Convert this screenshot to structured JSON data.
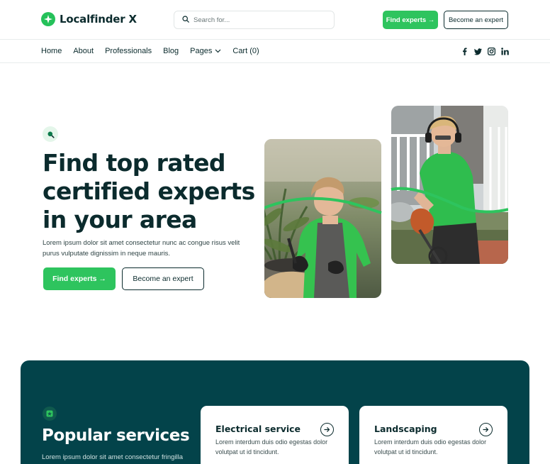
{
  "brand": {
    "name": "Localfinder X",
    "accent": "#2ec45e",
    "dark": "#03434a",
    "text": "#0b2b2d"
  },
  "search": {
    "placeholder": "Search for..."
  },
  "header": {
    "find_label": "Find experts →",
    "become_label": "Become an expert"
  },
  "nav": {
    "items": [
      {
        "label": "Home"
      },
      {
        "label": "About"
      },
      {
        "label": "Professionals"
      },
      {
        "label": "Blog"
      },
      {
        "label": "Pages",
        "icon": "chevron-down-icon"
      },
      {
        "label": "Cart (0)"
      }
    ],
    "socials": [
      "facebook-icon",
      "twitter-icon",
      "instagram-icon",
      "linkedin-icon"
    ]
  },
  "hero": {
    "badge_icon": "search-icon",
    "title": "Find top rated certified experts in your area",
    "description": "Lorem ipsum dolor sit amet consectetur nunc ac congue risus velit purus vulputate dignissim in neque mauris.",
    "find_label": "Find experts →",
    "become_label": "Become an expert"
  },
  "services": {
    "badge_icon": "star-icon",
    "title": "Popular services",
    "description": "Lorem ipsum dolor sit amet consectetur fringilla",
    "cards": [
      {
        "title": "Electrical service",
        "description": "Lorem interdum duis odio egestas dolor volutpat ut id tincidunt."
      },
      {
        "title": "Landscaping",
        "description": "Lorem interdum duis odio egestas dolor volutpat ut id tincidunt."
      }
    ]
  }
}
